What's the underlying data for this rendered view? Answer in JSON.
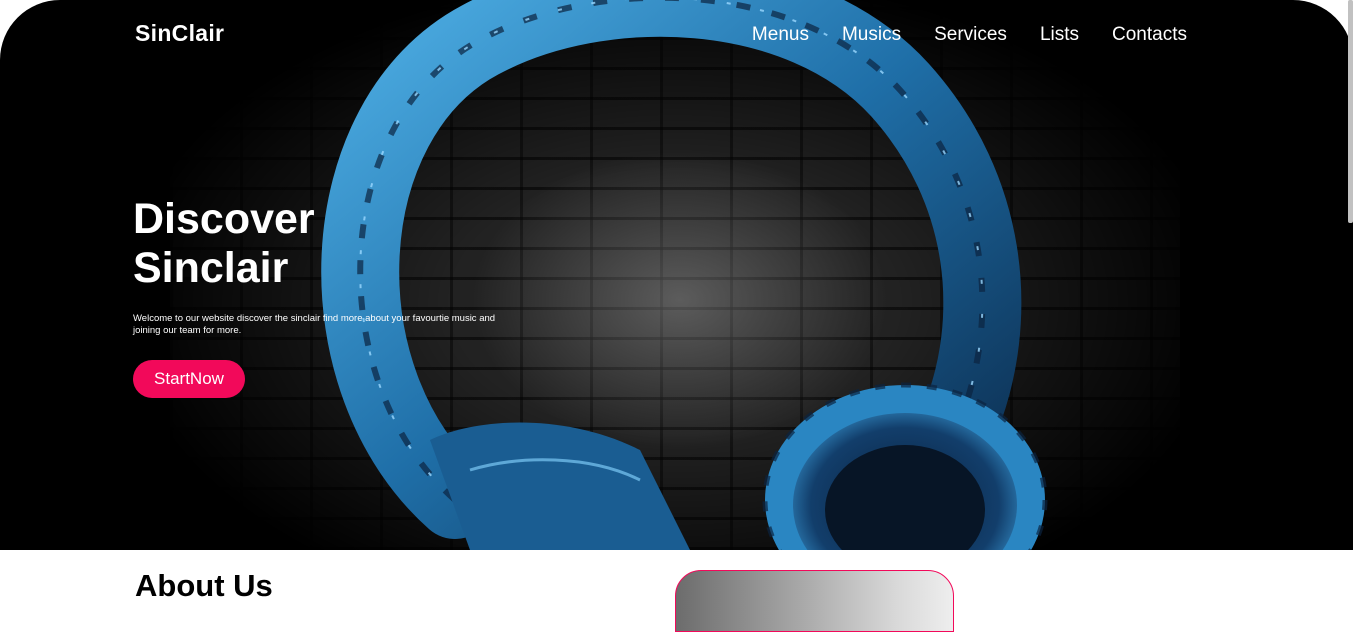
{
  "header": {
    "brand": "SinClair",
    "nav": [
      "Menus",
      "Musics",
      "Services",
      "Lists",
      "Contacts"
    ]
  },
  "hero": {
    "title_line1": "Discover",
    "title_line2": "Sinclair",
    "intro": "Welcome to our website discover the sinclair find more about your favourtie music and joining our team for more.",
    "cta_label": "StartNow"
  },
  "about": {
    "title": "About Us"
  },
  "colors": {
    "accent": "#f2095a",
    "hero_background": "#000000",
    "headphone_blue": "#2f8ccb"
  }
}
